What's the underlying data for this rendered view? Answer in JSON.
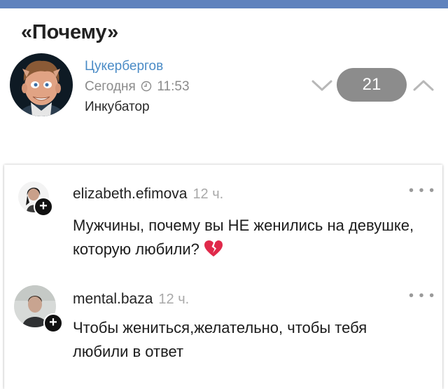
{
  "post": {
    "title": "«Почему»",
    "author": "Цукербергов",
    "date": "Сегодня",
    "time": "11:53",
    "community": "Инкубатор",
    "rating": "21"
  },
  "comments": [
    {
      "username": "elizabeth.efimova",
      "age": "12 ч.",
      "text": "Мужчины, почему вы НЕ женились на девушке, которую любили?"
    },
    {
      "username": "mental.baza",
      "age": "12 ч.",
      "text": "Чтобы жениться,желательно, чтобы тебя любили в ответ"
    }
  ],
  "icons": {
    "more": "more-dots-icon",
    "follow": "plus-icon",
    "broken_heart": "broken-heart-icon",
    "clock": "clock-icon"
  },
  "colors": {
    "topbar": "#5f82bd",
    "author_link": "#4a8bc6",
    "rating_bg": "#8c8c8c",
    "heart": "#e0294a"
  }
}
